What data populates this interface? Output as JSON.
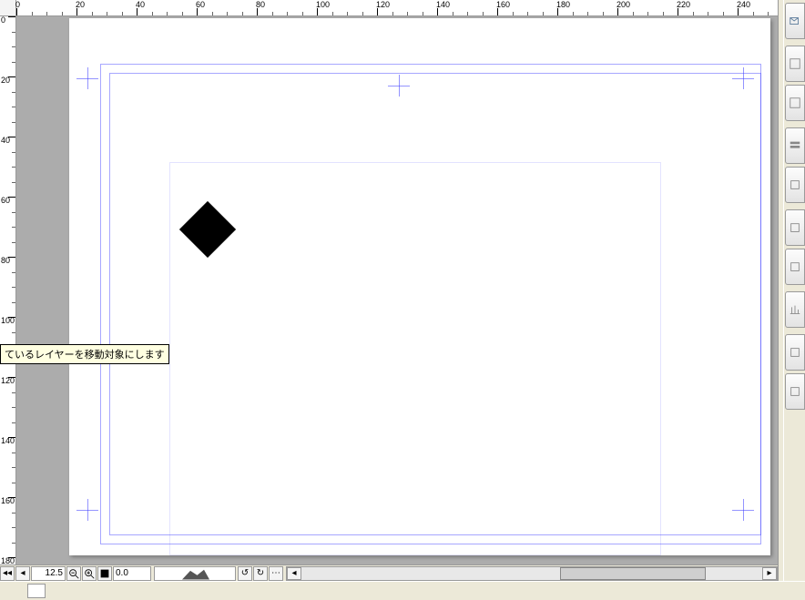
{
  "ruler": {
    "h_labels": [
      "0",
      "20",
      "40",
      "60",
      "80",
      "100",
      "120",
      "140",
      "160",
      "180",
      "200",
      "220",
      "240"
    ],
    "v_labels": [
      "0",
      "20",
      "40",
      "60",
      "80",
      "100",
      "120",
      "140",
      "160",
      "180"
    ]
  },
  "tooltip": {
    "text": "ているレイヤーを移動対象にします"
  },
  "statusbar": {
    "zoom_value": "12.5",
    "input_value": "0.0"
  },
  "dock": {
    "tabs": [
      {
        "name": "panel-tab-1"
      },
      {
        "name": "panel-tab-2"
      },
      {
        "name": "panel-tab-3"
      },
      {
        "name": "panel-tab-4"
      },
      {
        "name": "panel-tab-5"
      },
      {
        "name": "panel-tab-6"
      },
      {
        "name": "panel-tab-7"
      },
      {
        "name": "panel-tab-8"
      },
      {
        "name": "panel-tab-9"
      },
      {
        "name": "panel-tab-10"
      }
    ]
  }
}
